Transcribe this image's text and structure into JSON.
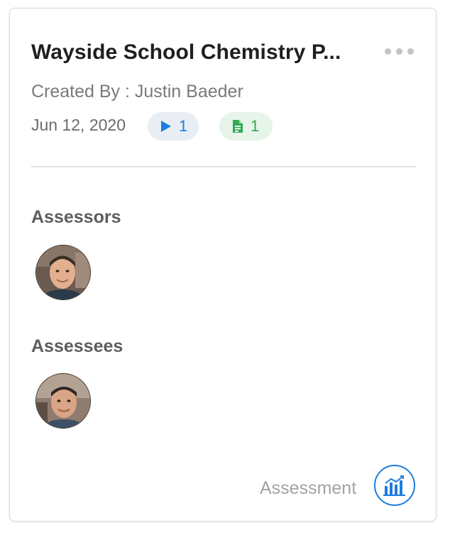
{
  "card": {
    "title": "Wayside School Chemistry P...",
    "created_by": "Created By : Justin Baeder",
    "date": "Jun 12, 2020",
    "video_count": "1",
    "document_count": "1",
    "assessors_label": "Assessors",
    "assessees_label": "Assessees",
    "assessors": [
      {
        "name": "avatar"
      }
    ],
    "assessees": [
      {
        "name": "avatar"
      }
    ],
    "footer_label": "Assessment"
  },
  "colors": {
    "accent_blue": "#1e7be0",
    "doc_green": "#34a853",
    "video_pill_bg": "#e9eef5",
    "doc_pill_bg": "#e6f4ea"
  },
  "icons": [
    "more-icon",
    "play-icon",
    "document-icon",
    "analytics-icon"
  ]
}
